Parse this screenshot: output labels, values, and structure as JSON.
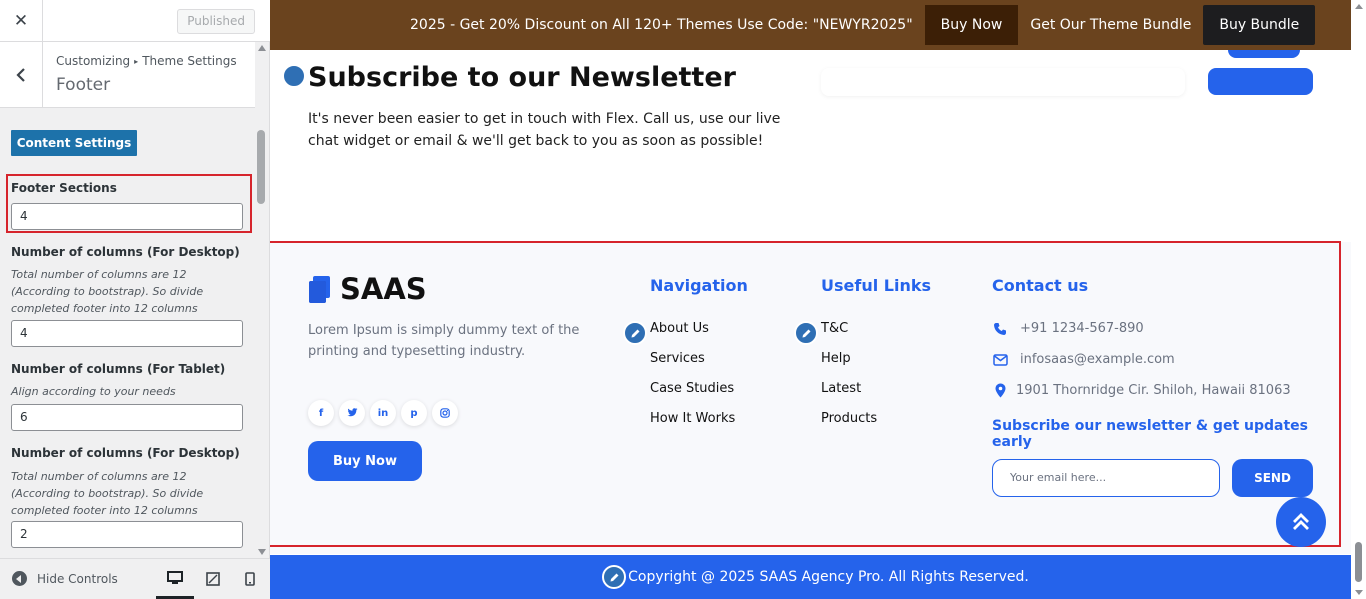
{
  "customizer": {
    "close_icon": "close-icon",
    "published_label": "Published",
    "breadcrumb": [
      "Customizing",
      "Theme Settings"
    ],
    "section_title": "Footer",
    "content_settings_label": "Content Settings",
    "fields": [
      {
        "label": "Footer Sections",
        "description": "",
        "value": "4"
      },
      {
        "label": "Number of columns (For Desktop)",
        "description": "Total number of columns are 12 (According to bootstrap). So divide completed footer into 12 columns",
        "value": "4"
      },
      {
        "label": "Number of columns (For Tablet)",
        "description": "Align according to your needs",
        "value": "6"
      },
      {
        "label": "Number of columns (For Desktop)",
        "description": "Total number of columns are 12 (According to bootstrap). So divide completed footer into 12 columns",
        "value": "2"
      }
    ],
    "hide_controls_label": "Hide Controls",
    "devices": [
      "desktop-icon",
      "tablet-icon",
      "mobile-icon"
    ]
  },
  "banner": {
    "promo_text": "2025 - Get 20% Discount on All 120+ Themes Use Code: \"NEWYR2025\"",
    "buy_now_label": "Buy Now",
    "bundle_text": "Get Our Theme Bundle",
    "buy_bundle_label": "Buy Bundle"
  },
  "newsletter": {
    "title": "Subscribe to our Newsletter",
    "text": "It's never been easier to get in touch with Flex. Call us, use our live chat widget or email & we'll get back to you as soon as possible!"
  },
  "footer": {
    "logo_text": "SAAS",
    "about": "Lorem Ipsum is simply dummy text of the printing and typesetting industry.",
    "socials": [
      "f",
      "t",
      "in",
      "p",
      "ig"
    ],
    "buy_now_label": "Buy Now",
    "navigation": {
      "title": "Navigation",
      "links": [
        "About Us",
        "Services",
        "Case Studies",
        "How It Works"
      ]
    },
    "useful_links": {
      "title": "Useful Links",
      "links": [
        "T&C",
        "Help",
        "Latest",
        "Products"
      ]
    },
    "contact": {
      "title": "Contact us",
      "phone": "+91 1234-567-890",
      "email": "infosaas@example.com",
      "address": "1901 Thornridge Cir. Shiloh, Hawaii 81063"
    },
    "subscribe_text": "Subscribe our newsletter & get updates early",
    "email_placeholder": "Your email here...",
    "send_label": "SEND",
    "copyright": "Copyright @ 2025 SAAS Agency Pro. All Rights Reserved."
  },
  "colors": {
    "accent": "#2563eb",
    "banner": "#6a431e",
    "highlight": "#d6242c",
    "wp_button": "#1d72aa"
  }
}
